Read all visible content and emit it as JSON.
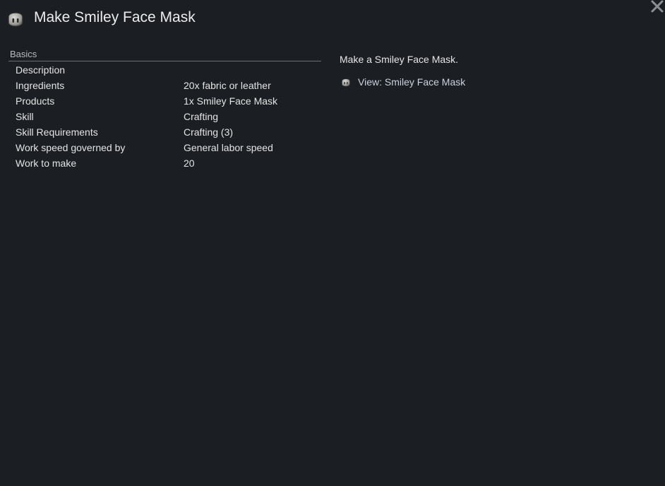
{
  "window": {
    "title": "Make Smiley Face Mask",
    "title_icon": "smiley-mask-icon",
    "close_icon": "close-icon"
  },
  "basics": {
    "section_label": "Basics",
    "rows": [
      {
        "label": "Description",
        "value": ""
      },
      {
        "label": "Ingredients",
        "value": "20x fabric or leather"
      },
      {
        "label": "Products",
        "value": "1x Smiley Face Mask"
      },
      {
        "label": "Skill",
        "value": "Crafting"
      },
      {
        "label": "Skill Requirements",
        "value": "Crafting (3)"
      },
      {
        "label": "Work speed governed by",
        "value": "General labor speed"
      },
      {
        "label": "Work to make",
        "value": "20"
      }
    ]
  },
  "detail": {
    "description": "Make a Smiley Face Mask.",
    "view_link": "View: Smiley Face Mask",
    "view_icon": "smiley-mask-icon"
  },
  "colors": {
    "background": "#1b1e22",
    "text": "#e6e6e6",
    "link": "#c9d3e0",
    "rule": "#6b6f75"
  }
}
